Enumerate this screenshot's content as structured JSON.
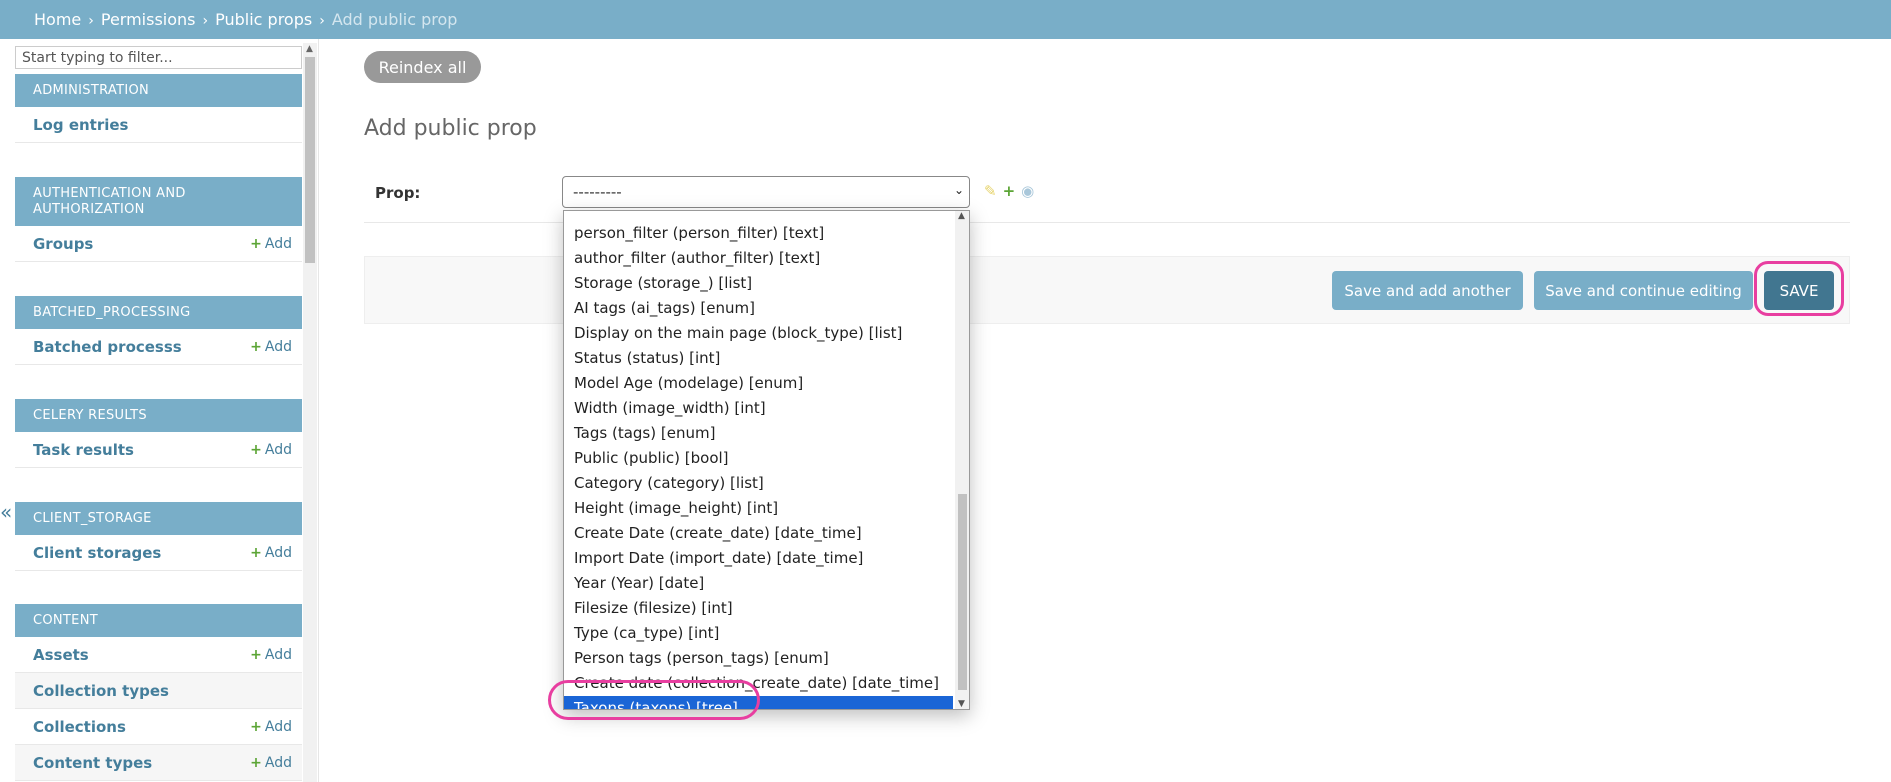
{
  "breadcrumbs": {
    "home": "Home",
    "permissions": "Permissions",
    "public_props": "Public props",
    "current": "Add public prop",
    "separator": "›"
  },
  "sidebar": {
    "filter_placeholder": "Start typing to filter...",
    "add_label": "Add",
    "collapse_icon": "«",
    "modules": [
      {
        "header": "ADMINISTRATION",
        "items": [
          {
            "name": "Log entries",
            "add": false
          }
        ]
      },
      {
        "header": "AUTHENTICATION AND AUTHORIZATION",
        "items": [
          {
            "name": "Groups",
            "add": true
          }
        ]
      },
      {
        "header": "BATCHED_PROCESSING",
        "items": [
          {
            "name": "Batched processs",
            "add": true
          }
        ]
      },
      {
        "header": "CELERY RESULTS",
        "items": [
          {
            "name": "Task results",
            "add": true
          }
        ]
      },
      {
        "header": "CLIENT_STORAGE",
        "items": [
          {
            "name": "Client storages",
            "add": true
          }
        ]
      },
      {
        "header": "CONTENT",
        "items": [
          {
            "name": "Assets",
            "add": true
          },
          {
            "name": "Collection types",
            "add": false
          },
          {
            "name": "Collections",
            "add": true
          },
          {
            "name": "Content types",
            "add": true
          }
        ]
      }
    ]
  },
  "main": {
    "reindex_label": "Reindex all",
    "title": "Add public prop",
    "prop_label": "Prop:",
    "select_value": "---------",
    "buttons": {
      "save_add_another": "Save and add another",
      "save_continue": "Save and continue editing",
      "save": "SAVE"
    }
  },
  "dropdown": {
    "options": [
      "person_filter (person_filter) [text]",
      "author_filter (author_filter) [text]",
      "Storage (storage_) [list]",
      "AI tags (ai_tags) [enum]",
      "Display on the main page (block_type) [list]",
      "Status (status) [int]",
      "Model Age (modelage) [enum]",
      "Width (image_width) [int]",
      "Tags (tags) [enum]",
      "Public (public) [bool]",
      "Category (category) [list]",
      "Height (image_height) [int]",
      "Create Date (create_date) [date_time]",
      "Import Date (import_date) [date_time]",
      "Year (Year) [date]",
      "Filesize (filesize) [int]",
      "Type (ca_type) [int]",
      "Person tags (person_tags) [enum]",
      "Create date (collection_create_date) [date_time]",
      "Taxons (taxons) [tree]"
    ],
    "selected_index": 19
  },
  "colors": {
    "header": "#79aec8",
    "link": "#447e9b",
    "save_button": "#417690",
    "highlight": "#e83ea0",
    "selected_option": "#1a65d6"
  }
}
